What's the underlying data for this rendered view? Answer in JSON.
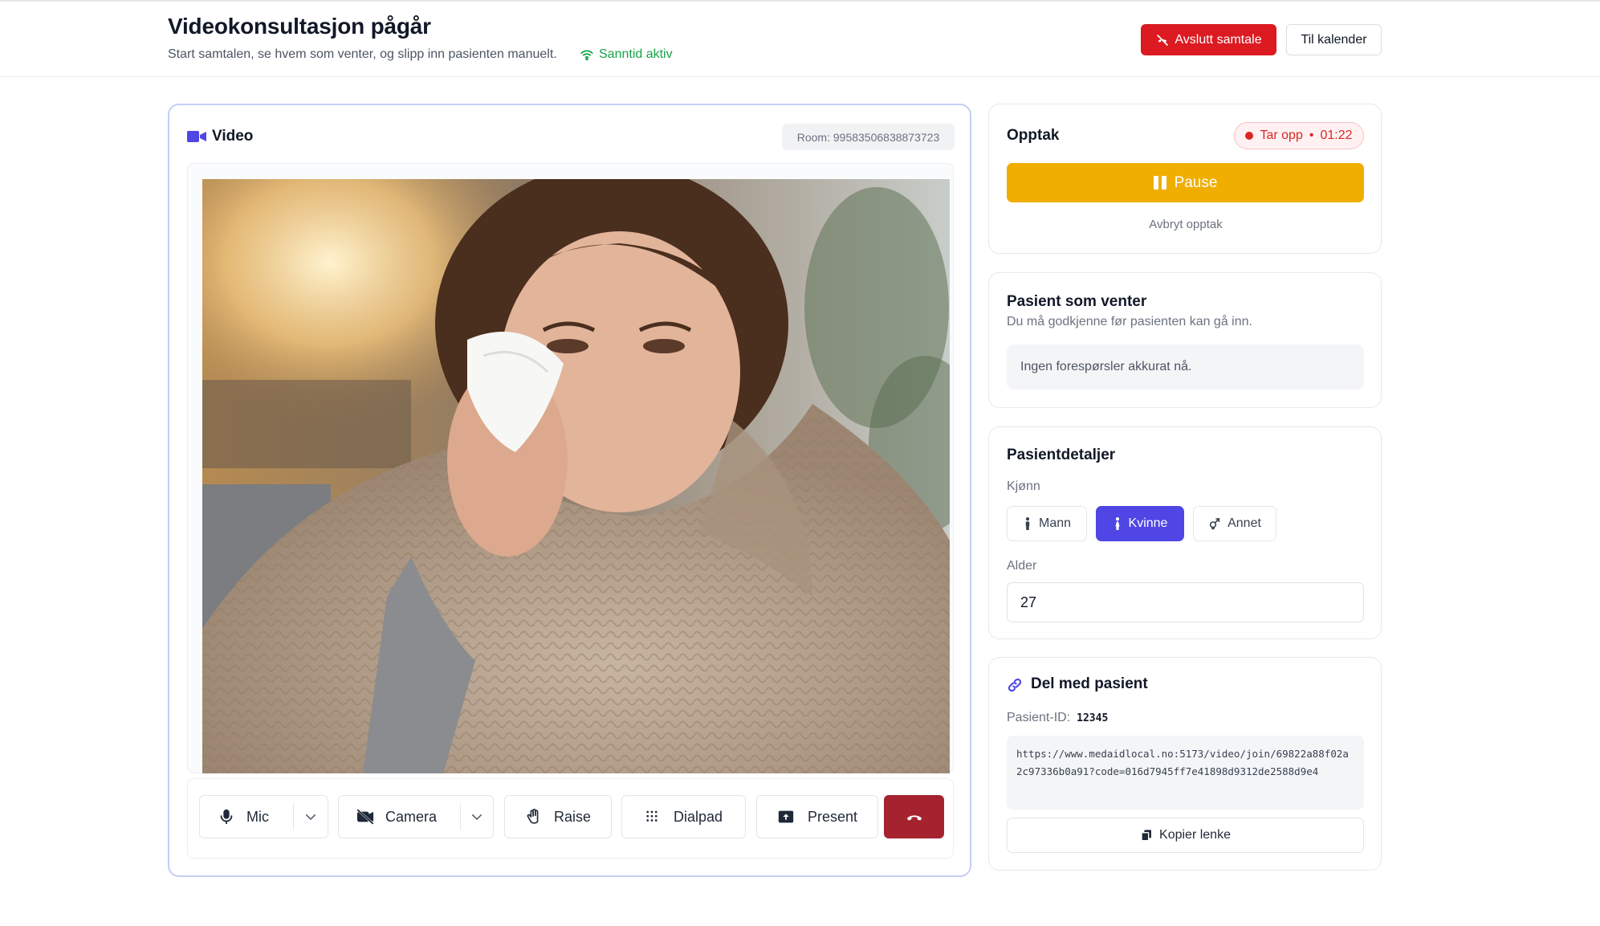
{
  "header": {
    "title": "Videokonsultasjon pågår",
    "subtitle": "Start samtalen, se hvem som venter, og slipp inn pasienten manuelt.",
    "live_status": "Sanntid aktiv",
    "end_call_label": "Avslutt samtale",
    "calendar_label": "Til kalender"
  },
  "video": {
    "title": "Video",
    "room": "Room: 99583506838873723",
    "controls": {
      "mic": "Mic",
      "camera": "Camera",
      "raise": "Raise",
      "dialpad": "Dialpad",
      "present": "Present"
    }
  },
  "recording": {
    "title": "Opptak",
    "status": "Tar opp",
    "elapsed": "01:22",
    "pause_label": "Pause",
    "cancel_label": "Avbryt opptak"
  },
  "waiting": {
    "title": "Pasient som venter",
    "description": "Du må godkjenne før pasienten kan gå inn.",
    "empty": "Ingen forespørsler akkurat nå."
  },
  "details": {
    "title": "Pasientdetaljer",
    "gender_label": "Kjønn",
    "gender_options": [
      "Mann",
      "Kvinne",
      "Annet"
    ],
    "gender_selected": "Kvinne",
    "age_label": "Alder",
    "age_value": "27"
  },
  "share": {
    "title": "Del med pasient",
    "patient_id_label": "Pasient-ID:",
    "patient_id": "12345",
    "link": "https://www.medaidlocal.no:5173/video/join/69822a88f02a2c97336b0a91?code=016d7945ff7e41898d9312de2588d9e4",
    "copy_label": "Kopier lenke"
  },
  "colors": {
    "accent": "#4f46e5",
    "danger": "#dc1a22",
    "pause": "#f0ae00",
    "live": "#16a34a",
    "hangup": "#a5232f"
  }
}
